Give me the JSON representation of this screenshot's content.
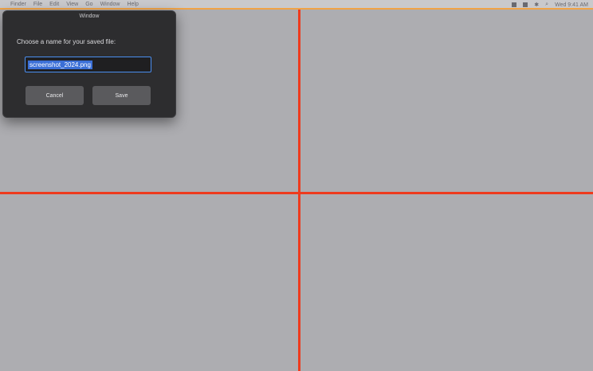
{
  "menubar": {
    "apple_icon": "",
    "items": [
      "Finder",
      "File",
      "Edit",
      "View",
      "Go",
      "Window",
      "Help"
    ],
    "status_text": "Wed 9:41 AM"
  },
  "dialog": {
    "title": "Window",
    "prompt": "Choose a name for your saved file:",
    "field_value": "screenshot_2024.png",
    "cancel_label": "Cancel",
    "save_label": "Save"
  },
  "colors": {
    "background": "#adadb1",
    "crosshair": "#ee3a1d",
    "dialog_bg": "#2d2d2f",
    "menubar_accent": "#f0a347"
  }
}
